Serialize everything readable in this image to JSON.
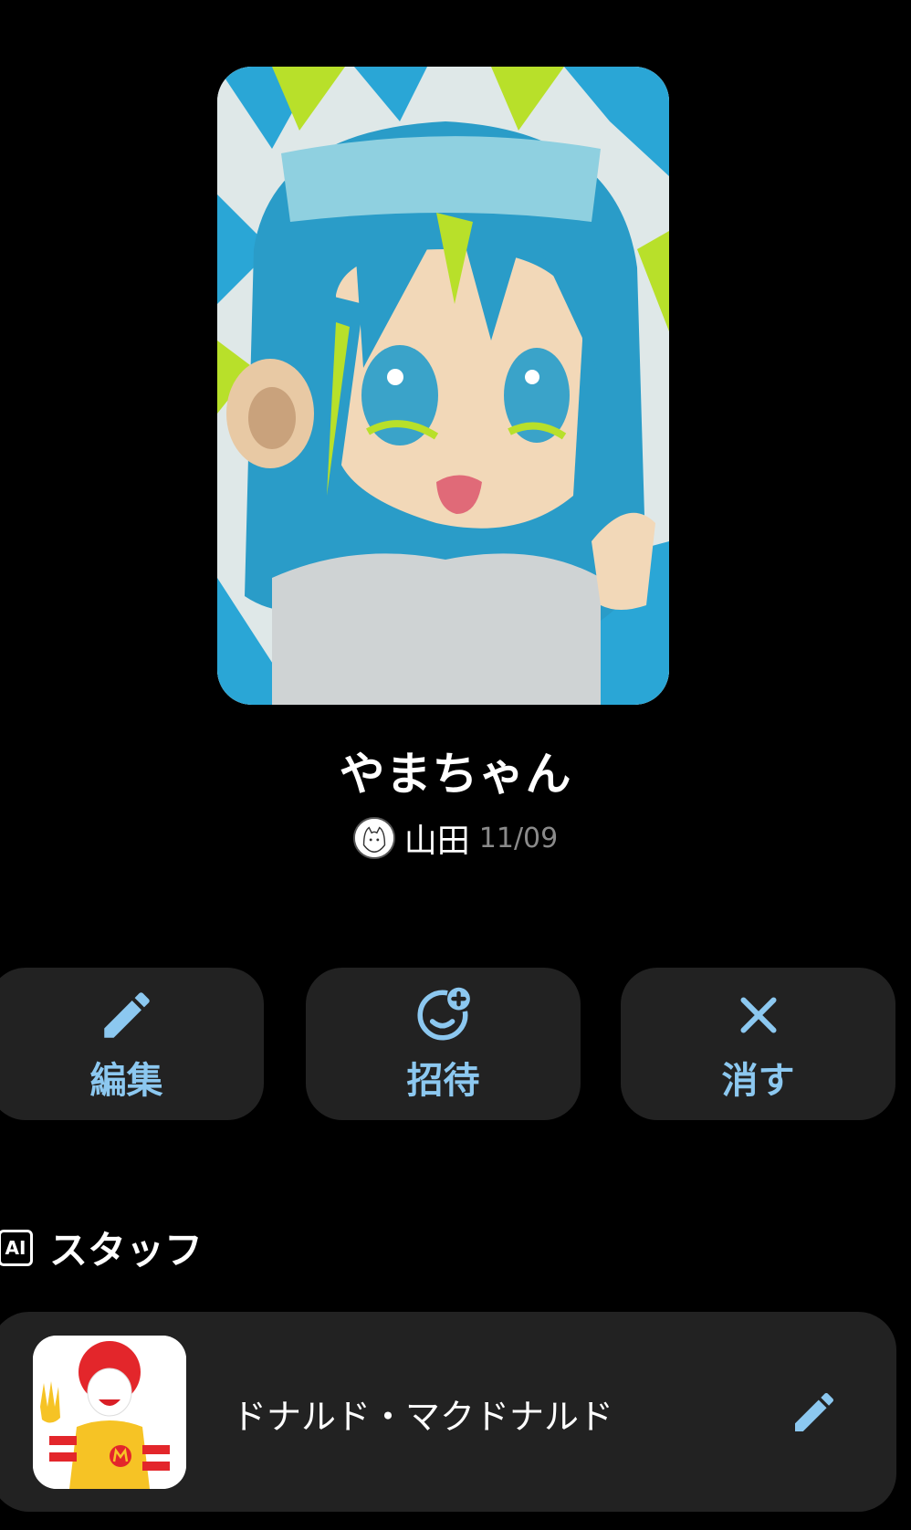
{
  "profile": {
    "name": "やまちゃん",
    "author": "山田",
    "date": "11/09"
  },
  "actions": {
    "edit_label": "編集",
    "invite_label": "招待",
    "delete_label": "消す"
  },
  "staff_section": {
    "badge": "AI",
    "title": "スタッフ",
    "members": [
      {
        "name": "ドナルド・マクドナルド"
      }
    ]
  },
  "colors": {
    "background": "#000000",
    "card": "#222222",
    "accent": "#8cc8f0",
    "muted_text": "#8a8a8a"
  },
  "icons": {
    "edit": "pencil-icon",
    "invite": "smiley-plus-icon",
    "delete": "close-icon",
    "staff_edit": "pencil-icon"
  }
}
